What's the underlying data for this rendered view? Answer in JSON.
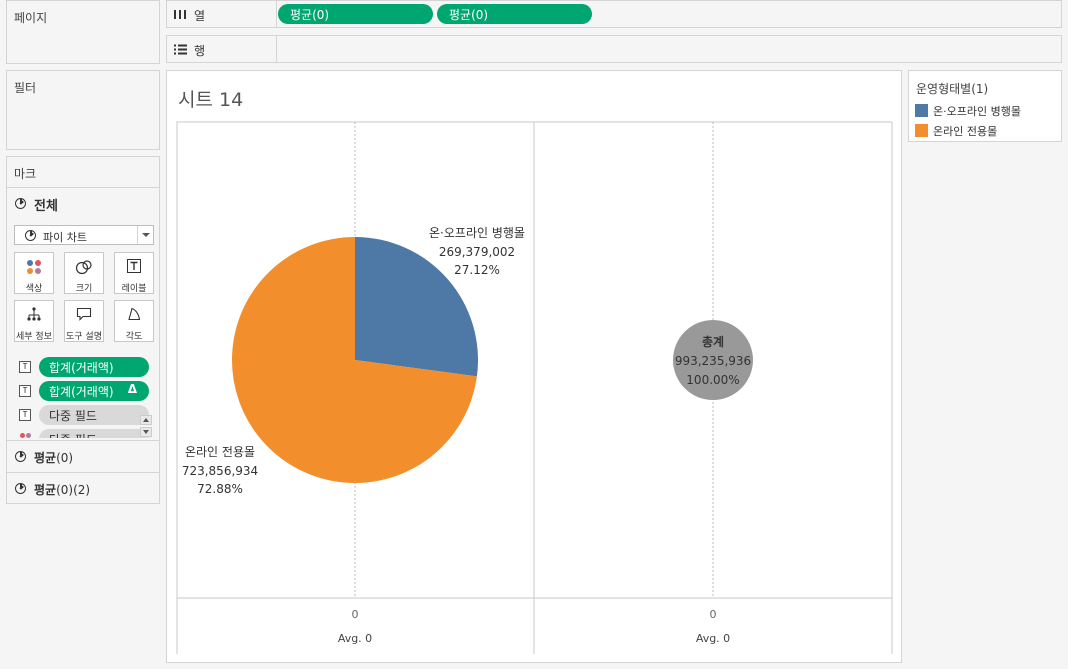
{
  "pages": {
    "title": "페이지"
  },
  "filters": {
    "title": "필터"
  },
  "marks": {
    "title": "마크",
    "all_label": "전체",
    "mark_type": "파이 차트",
    "buttons": [
      {
        "label": "색상",
        "icon": "color-dots-icon"
      },
      {
        "label": "크기",
        "icon": "size-circles-icon"
      },
      {
        "label": "레이블",
        "icon": "label-t-icon"
      },
      {
        "label": "세부 정보",
        "icon": "detail-tree-icon"
      },
      {
        "label": "도구 설명",
        "icon": "tooltip-speech-icon"
      },
      {
        "label": "각도",
        "icon": "angle-icon"
      }
    ],
    "fields": [
      {
        "text": "합계(거래액)",
        "style": "green"
      },
      {
        "text": "합계(거래액)",
        "style": "green",
        "badge": "Δ"
      },
      {
        "text": "다중 필드",
        "style": "grey"
      },
      {
        "text": "다중 필드",
        "style": "grey"
      }
    ],
    "layers": [
      {
        "name": "평균",
        "suffix": "(0)"
      },
      {
        "name": "평균",
        "suffix": "(0)(2)"
      }
    ]
  },
  "shelves": {
    "columns": {
      "label": "열",
      "pills": [
        "평균(0)",
        "평균(0)"
      ]
    },
    "rows": {
      "label": "행",
      "pills": []
    }
  },
  "sheet": {
    "title": "시트 14"
  },
  "legend": {
    "title": "운영형태별(1)",
    "items": [
      {
        "label": "온·오프라인 병행몰",
        "color": "#4e79a7"
      },
      {
        "label": "온라인 전용몰",
        "color": "#f28e2b"
      }
    ]
  },
  "chart_data": [
    {
      "type": "pie",
      "categories": [
        "온·오프라인 병행몰",
        "온라인 전용몰"
      ],
      "values": [
        269379002,
        723856934
      ],
      "value_labels": [
        "269,379,002",
        "723,856,934"
      ],
      "percent_labels": [
        "27.12%",
        "72.88%"
      ],
      "colors": [
        "#4e79a7",
        "#f28e2b"
      ],
      "x_tick_label": "0",
      "xlabel": "Avg. 0"
    },
    {
      "type": "pie",
      "categories": [
        "총계"
      ],
      "values": [
        993235936
      ],
      "value_labels": [
        "993,235,936"
      ],
      "percent_labels": [
        "100.00%"
      ],
      "colors": [
        "#999999"
      ],
      "x_tick_label": "0",
      "xlabel": "Avg. 0"
    }
  ]
}
